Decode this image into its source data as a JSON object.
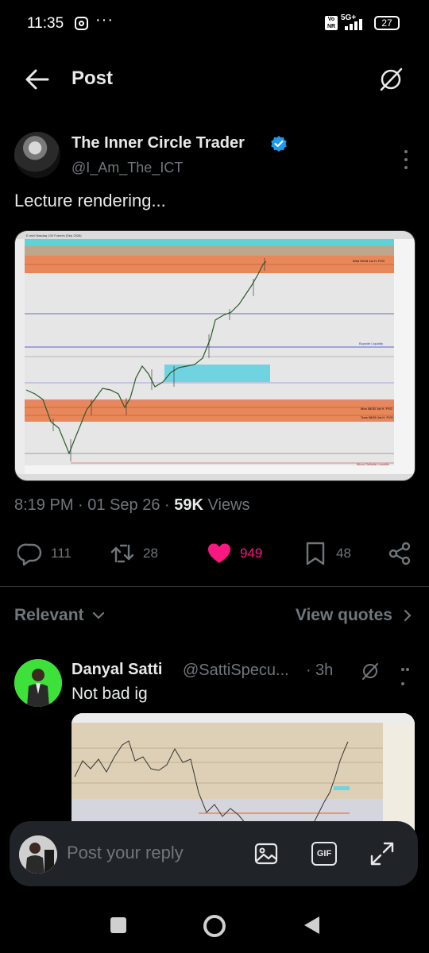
{
  "status_bar": {
    "time": "11:35",
    "more": "···",
    "volte": "Vo NR",
    "network": "5G+",
    "battery": "27"
  },
  "header": {
    "title": "Post"
  },
  "post": {
    "author_name": "The Inner Circle Trader",
    "author_handle": "@I_Am_The_ICT",
    "text": "Lecture rendering...",
    "time": "8:19 PM",
    "date": "01 Sep 26",
    "separator": "·",
    "views_count": "59K",
    "views_label": "Views",
    "chart_labels": {
      "instrument": "E-mini Nasdaq 100 Futures (Sep 2026)",
      "top_zone": "Wed 09/16 1st H. FVG",
      "buyside": "Buyside Liquidity",
      "mid_fvg": "Mon 08/30 1st H. FVG",
      "low_fvg": "Tues 08/30 1st H. FVG",
      "minor_sellside": "Minor Sellside Liquidity"
    },
    "accent_colors": {
      "fvg_zone": "#e8875a",
      "top_band": "#5fd2d8",
      "cyan_block": "#6fd3e0",
      "liquidity_line": "#5a62d6",
      "purple_line": "#9a2dbd"
    }
  },
  "actions": {
    "replies": "111",
    "reposts": "28",
    "likes": "949",
    "bookmarks": "48",
    "like_color": "#f91880"
  },
  "replies_section": {
    "sort_label": "Relevant",
    "quotes_label": "View quotes"
  },
  "reply": {
    "name": "Danyal Satti",
    "handle": "@SattiSpecu...",
    "separator": "·",
    "time": "3h",
    "text": "Not bad ig",
    "avatar_bg": "#3ee13a"
  },
  "composer": {
    "placeholder": "Post your reply",
    "gif_label": "GIF"
  }
}
